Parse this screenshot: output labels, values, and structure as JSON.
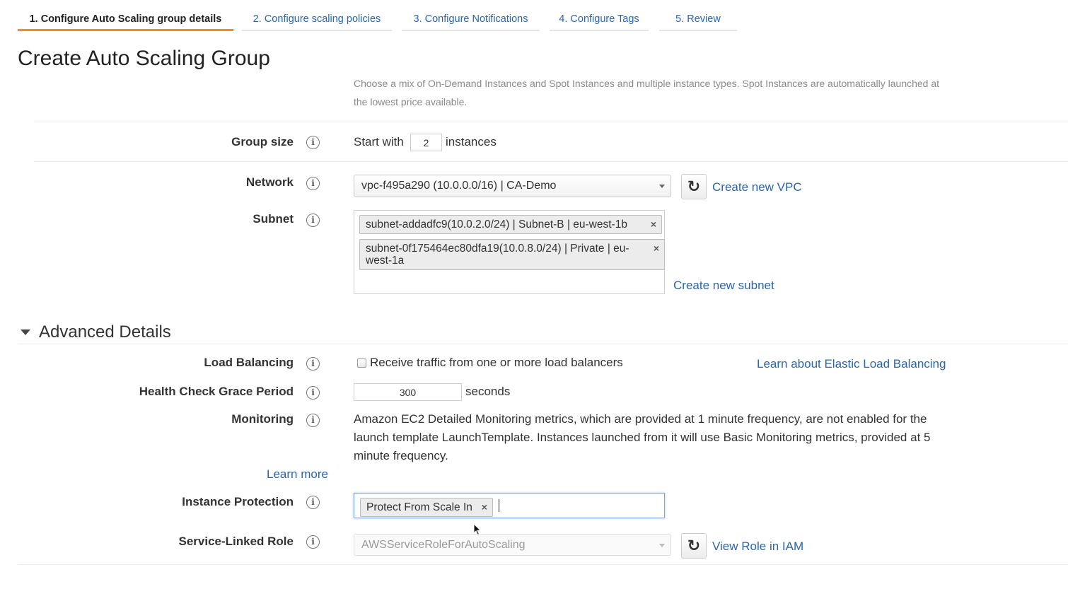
{
  "wizard": {
    "tabs": [
      {
        "label": "1. Configure Auto Scaling group details"
      },
      {
        "label": "2. Configure scaling policies"
      },
      {
        "label": "3. Configure Notifications"
      },
      {
        "label": "4. Configure Tags"
      },
      {
        "label": "5. Review"
      }
    ],
    "active_tab": 0
  },
  "page": {
    "title": "Create Auto Scaling Group",
    "description": "Choose a mix of On-Demand Instances and Spot Instances and multiple instance types. Spot Instances are automatically launched at the lowest price available."
  },
  "group_size": {
    "label": "Group size",
    "prefix": "Start with",
    "value": "2",
    "suffix": "instances"
  },
  "network": {
    "label": "Network",
    "selected": "vpc-f495a290 (10.0.0.0/16) | CA-Demo",
    "create_link": "Create new VPC"
  },
  "subnet": {
    "label": "Subnet",
    "chips": [
      "subnet-addadfc9(10.0.2.0/24) | Subnet-B | eu-west-1b",
      "subnet-0f175464ec80dfa19(10.0.8.0/24) | Private | eu-west-1a"
    ],
    "remove_glyph": "×",
    "create_link": "Create new subnet"
  },
  "advanced": {
    "title": "Advanced Details",
    "load_balancing": {
      "label": "Load Balancing",
      "checkbox_label": "Receive traffic from one or more load balancers",
      "checked": false,
      "learn_link": "Learn about Elastic Load Balancing"
    },
    "health_check": {
      "label": "Health Check Grace Period",
      "value": "300",
      "unit": "seconds"
    },
    "monitoring": {
      "label": "Monitoring",
      "text": "Amazon EC2 Detailed Monitoring metrics, which are provided at 1 minute frequency, are not enabled for the launch template LaunchTemplate. Instances launched from it will use Basic Monitoring metrics, provided at 5 minute frequency.",
      "learn_more": "Learn more"
    },
    "instance_protection": {
      "label": "Instance Protection",
      "chip": "Protect From Scale In"
    },
    "service_role": {
      "label": "Service-Linked Role",
      "selected": "AWSServiceRoleForAutoScaling",
      "view_link": "View Role in IAM"
    }
  },
  "icons": {
    "info": "i",
    "refresh": "↻"
  },
  "colors": {
    "link": "#2b66a8",
    "active_tab_underline": "#ec8f22"
  }
}
